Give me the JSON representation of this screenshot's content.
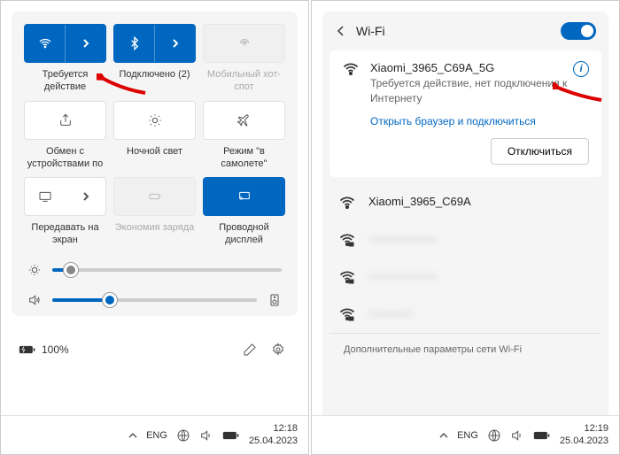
{
  "left": {
    "tiles": {
      "wifi_label": "Требуется действие",
      "bt_label": "Подключено (2)",
      "hotspot_label": "Мобильный хот-спот",
      "share_label": "Обмен с устройствами по",
      "nightlight_label": "Ночной свет",
      "airplane_label": "Режим \"в самолете\"",
      "cast_label": "Передавать на экран",
      "battery_saver_label": "Экономия заряда",
      "wired_label": "Проводной дисплей"
    },
    "brightness": 8,
    "volume": 28,
    "battery": "100%"
  },
  "right": {
    "title": "Wi-Fi",
    "network": {
      "name": "Xiaomi_3965_C69A_5G",
      "status": "Требуется действие, нет подключения к Интернету",
      "link": "Открыть браузер и подключиться",
      "disconnect": "Отключиться"
    },
    "others": [
      "Xiaomi_3965_C69A",
      "——————",
      "——————",
      "————"
    ],
    "footer": "Дополнительные параметры сети Wi-Fi"
  },
  "taskbar": {
    "lang": "ENG",
    "left": {
      "time": "12:18",
      "date": "25.04.2023"
    },
    "right": {
      "time": "12:19",
      "date": "25.04.2023"
    }
  }
}
